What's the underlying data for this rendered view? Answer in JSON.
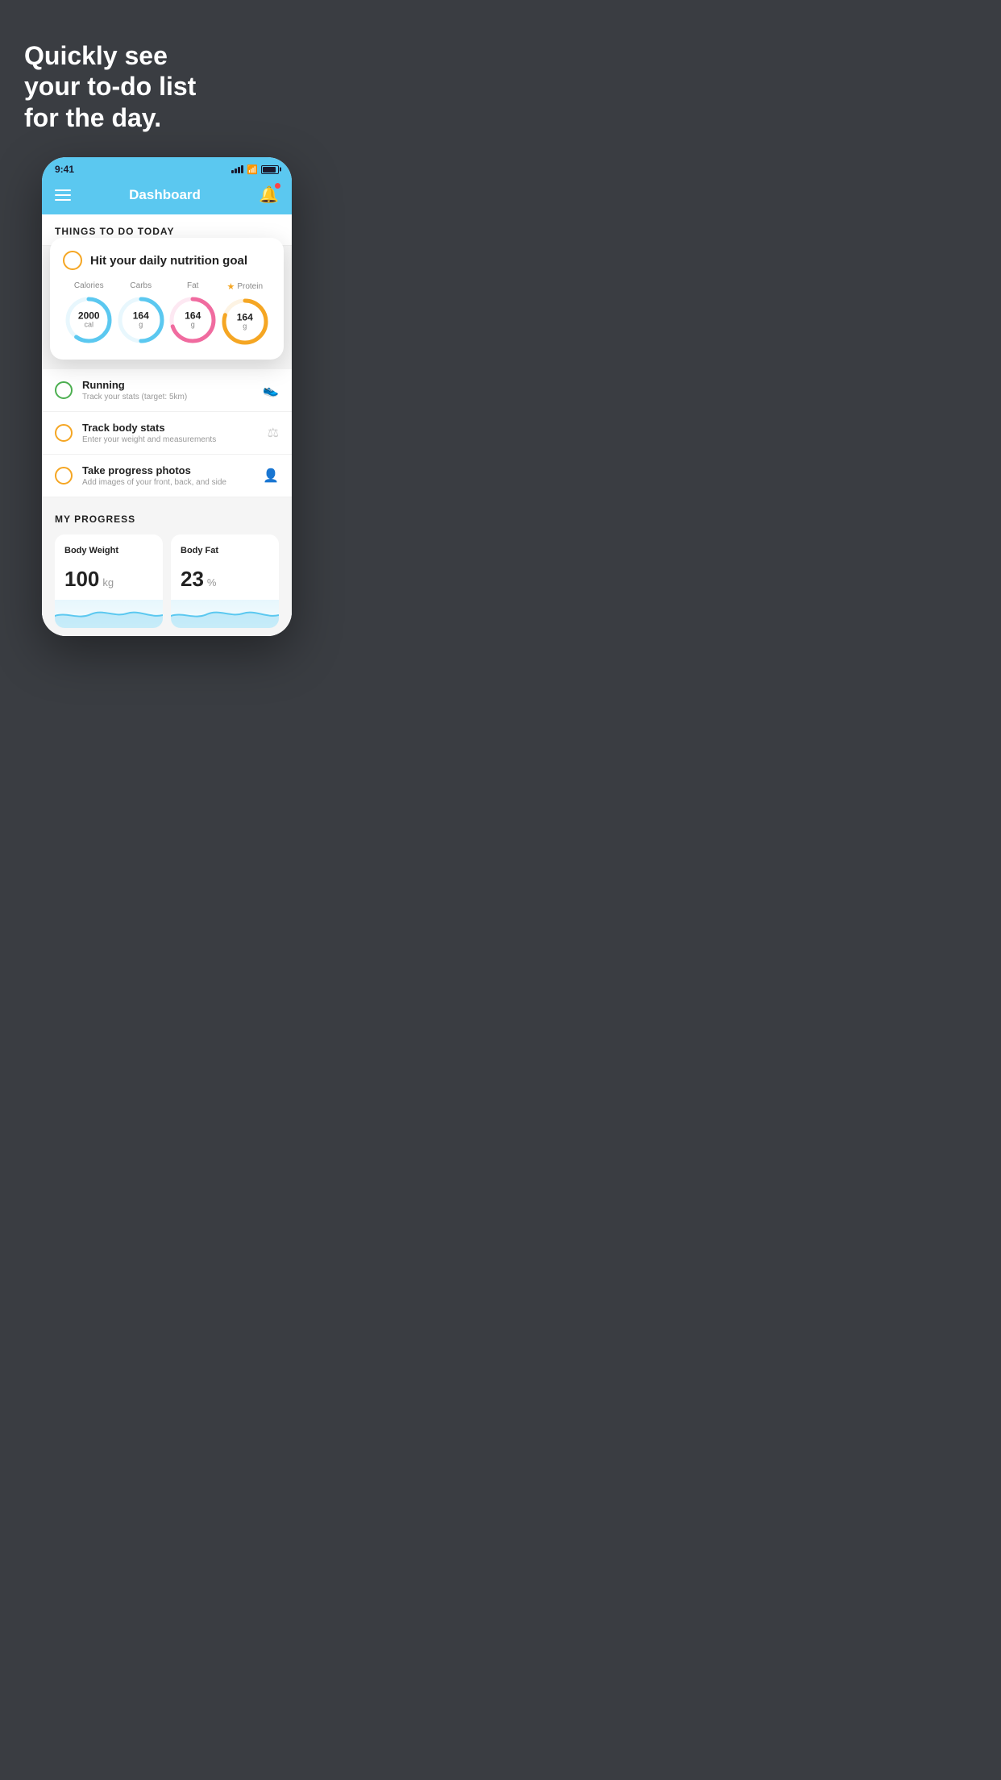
{
  "hero": {
    "line1": "Quickly see",
    "line2": "your to-do list",
    "line3": "for the day."
  },
  "status_bar": {
    "time": "9:41"
  },
  "nav": {
    "title": "Dashboard"
  },
  "things_header": "THINGS TO DO TODAY",
  "floating_card": {
    "title": "Hit your daily nutrition goal",
    "nutrition": [
      {
        "label": "Calories",
        "value": "2000",
        "unit": "cal",
        "color": "#5bc8f0",
        "trail": "#e8f7fd",
        "star": false,
        "percent": 60
      },
      {
        "label": "Carbs",
        "value": "164",
        "unit": "g",
        "color": "#5bc8f0",
        "trail": "#e8f7fd",
        "star": false,
        "percent": 50
      },
      {
        "label": "Fat",
        "value": "164",
        "unit": "g",
        "color": "#f06b9f",
        "trail": "#fde8f2",
        "star": false,
        "percent": 70
      },
      {
        "label": "Protein",
        "value": "164",
        "unit": "g",
        "color": "#f5a623",
        "trail": "#fdf3e3",
        "star": true,
        "percent": 80
      }
    ]
  },
  "todo_items": [
    {
      "type": "green",
      "title": "Running",
      "subtitle": "Track your stats (target: 5km)",
      "icon": "shoe"
    },
    {
      "type": "yellow",
      "title": "Track body stats",
      "subtitle": "Enter your weight and measurements",
      "icon": "scale"
    },
    {
      "type": "yellow",
      "title": "Take progress photos",
      "subtitle": "Add images of your front, back, and side",
      "icon": "person"
    }
  ],
  "progress": {
    "header": "MY PROGRESS",
    "cards": [
      {
        "title": "Body Weight",
        "value": "100",
        "unit": "kg"
      },
      {
        "title": "Body Fat",
        "value": "23",
        "unit": "%"
      }
    ]
  }
}
